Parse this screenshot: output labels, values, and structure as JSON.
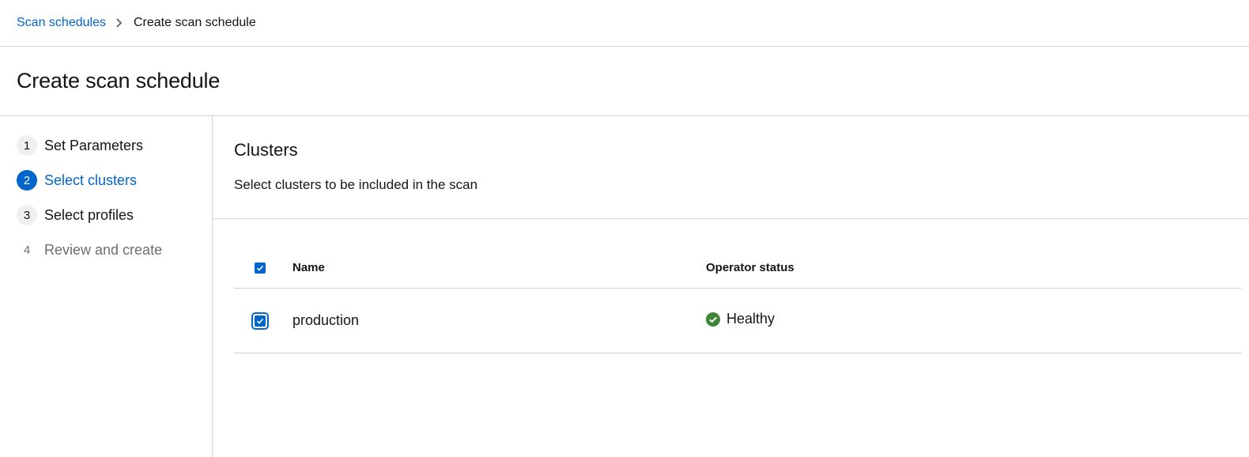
{
  "breadcrumb": {
    "parent": "Scan schedules",
    "current": "Create scan schedule"
  },
  "page": {
    "title": "Create scan schedule"
  },
  "wizard": {
    "steps": [
      {
        "number": "1",
        "label": "Set Parameters",
        "state": "visited"
      },
      {
        "number": "2",
        "label": "Select clusters",
        "state": "current"
      },
      {
        "number": "3",
        "label": "Select profiles",
        "state": "visited"
      },
      {
        "number": "4",
        "label": "Review and create",
        "state": "disabled"
      }
    ]
  },
  "section": {
    "title": "Clusters",
    "description": "Select clusters to be included in the scan"
  },
  "table": {
    "columns": {
      "name": "Name",
      "status": "Operator status"
    },
    "rows": [
      {
        "name": "production",
        "status": "Healthy",
        "selected": true
      }
    ]
  },
  "colors": {
    "accent": "#0066cc",
    "healthy": "#3e8635",
    "border": "#d2d2d2"
  },
  "icons": {
    "breadcrumb_separator": "chevron-right-icon",
    "checkbox": "checkmark-icon",
    "status": "check-circle-icon"
  }
}
